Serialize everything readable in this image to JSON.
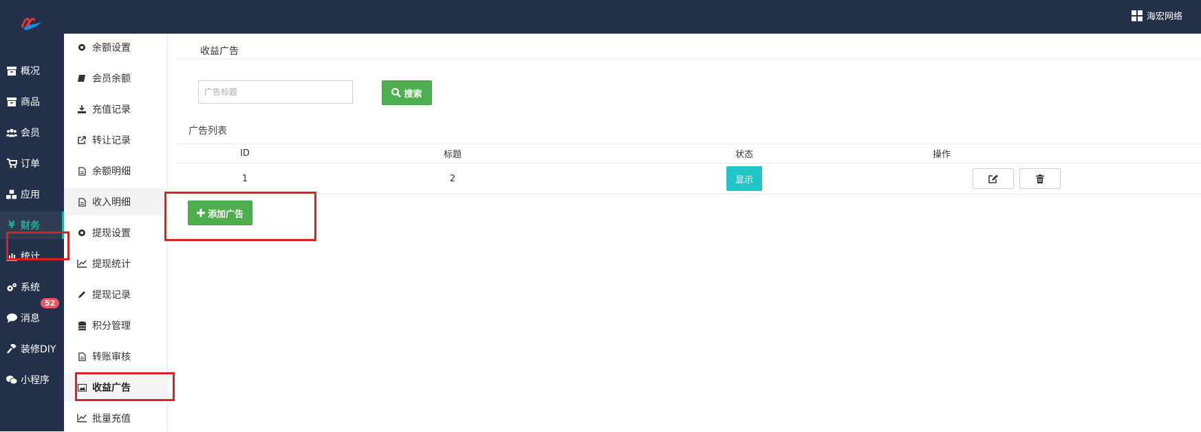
{
  "topbar": {
    "user_name": "海宏网络"
  },
  "nav": {
    "items": [
      {
        "label": "概况",
        "icon": "archive-icon"
      },
      {
        "label": "商品",
        "icon": "archive-icon"
      },
      {
        "label": "会员",
        "icon": "users-icon"
      },
      {
        "label": "订单",
        "icon": "cart-icon"
      },
      {
        "label": "应用",
        "icon": "cubes-icon"
      },
      {
        "label": "财务",
        "icon": "yen-icon",
        "active": true
      },
      {
        "label": "统计",
        "icon": "bar-chart-icon"
      },
      {
        "label": "系统",
        "icon": "gears-icon"
      },
      {
        "label": "消息",
        "icon": "comment-icon",
        "badge": "52"
      },
      {
        "label": "装修DIY",
        "icon": "gavel-icon"
      },
      {
        "label": "小程序",
        "icon": "wechat-icon"
      }
    ]
  },
  "subnav": {
    "items": [
      {
        "label": "余额设置",
        "icon": "gear-icon"
      },
      {
        "label": "会员余额",
        "icon": "book-icon"
      },
      {
        "label": "充值记录",
        "icon": "download-icon"
      },
      {
        "label": "转让记录",
        "icon": "external-link-icon"
      },
      {
        "label": "余额明细",
        "icon": "file-icon"
      },
      {
        "label": "收入明细",
        "icon": "file-icon"
      },
      {
        "label": "提现设置",
        "icon": "gear-icon"
      },
      {
        "label": "提现统计",
        "icon": "line-chart-icon"
      },
      {
        "label": "提现记录",
        "icon": "pencil-icon"
      },
      {
        "label": "积分管理",
        "icon": "database-icon"
      },
      {
        "label": "转账审核",
        "icon": "file-icon"
      },
      {
        "label": "收益广告",
        "icon": "image-icon",
        "active": true
      },
      {
        "label": "批量充值",
        "icon": "line-chart-icon"
      }
    ]
  },
  "main": {
    "page_title": "收益广告",
    "search": {
      "placeholder": "广告标题",
      "button_label": "搜索"
    },
    "list_title": "广告列表",
    "table": {
      "columns": [
        "ID",
        "标题",
        "状态",
        "操作"
      ],
      "rows": [
        {
          "id": "1",
          "title": "2",
          "status": "显示"
        }
      ]
    },
    "add_button_label": "添加广告"
  },
  "colors": {
    "topbar_bg": "#23304a",
    "accent_green": "#4cae4c",
    "status_cyan": "#23c6c8",
    "annotation_red": "#e02020",
    "badge_red": "#ed5565"
  }
}
